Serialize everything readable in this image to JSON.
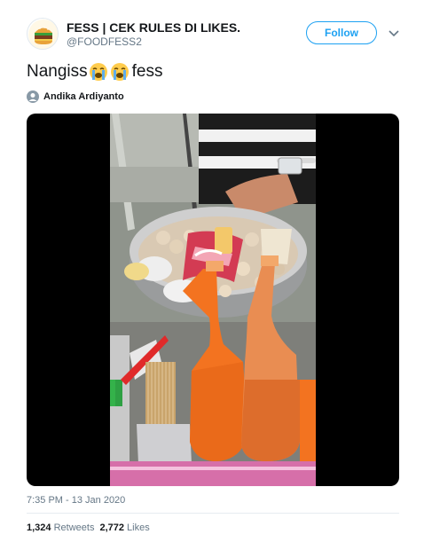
{
  "account": {
    "display_name": "FESS | CEK RULES DI LIKES.",
    "handle": "@FOODFESS2",
    "avatar_icon": "burger-icon"
  },
  "follow_label": "Follow",
  "menu_icon": "chevron-down-icon",
  "tweet": {
    "text_before": "Nangiss",
    "emoji": "loudly-crying-face",
    "text_after": "fess"
  },
  "tagged_user": "Andika Ardiyanto",
  "media": {
    "type": "video",
    "icon": "video-thumbnail"
  },
  "timestamp": "7:35 PM - 13 Jan 2020",
  "stats": {
    "retweets_count": "1,324",
    "retweets_label": "Retweets",
    "likes_count": "2,772",
    "likes_label": "Likes"
  },
  "colors": {
    "accent": "#1da1f2",
    "muted": "#657786",
    "text": "#14171a"
  }
}
